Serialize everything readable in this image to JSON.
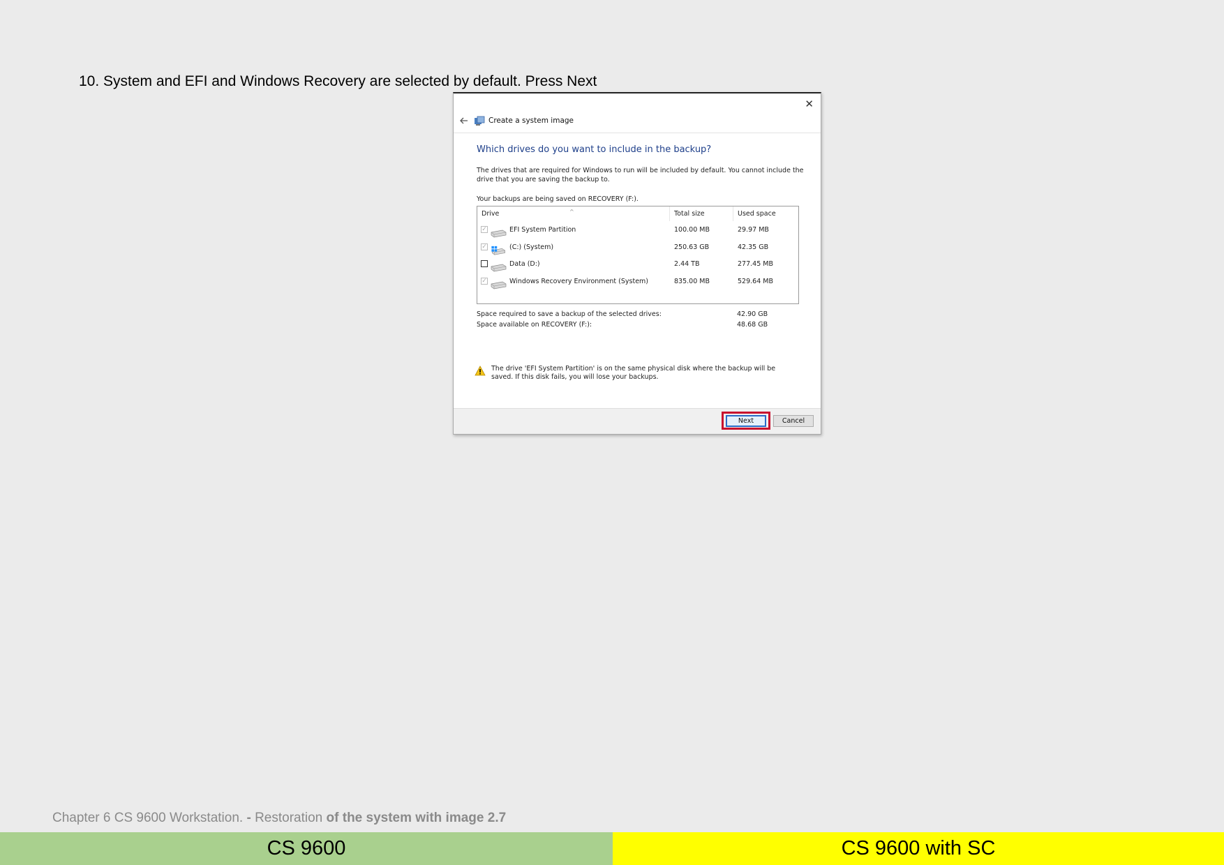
{
  "instruction": "10. System and EFI and Windows Recovery are selected by default. Press Next",
  "dialog": {
    "close_glyph": "✕",
    "title": "Create a system image",
    "heading": "Which drives do you want to include in the backup?",
    "description": "The drives that are required for Windows to run will be included by default. You cannot include the drive that you are saving the backup to.",
    "saved_on": "Your backups are being saved on RECOVERY (F:).",
    "columns": {
      "drive": "Drive",
      "total": "Total size",
      "used": "Used space"
    },
    "drives": [
      {
        "name": "EFI System Partition",
        "total": "100.00 MB",
        "used": "29.97 MB",
        "checked": true,
        "disabled": true,
        "icon": "drive-icon"
      },
      {
        "name": "(C:) (System)",
        "total": "250.63 GB",
        "used": "42.35 GB",
        "checked": true,
        "disabled": true,
        "icon": "windows-drive-icon"
      },
      {
        "name": "Data (D:)",
        "total": "2.44 TB",
        "used": "277.45 MB",
        "checked": false,
        "disabled": false,
        "icon": "drive-icon"
      },
      {
        "name": "Windows Recovery Environment (System)",
        "total": "835.00 MB",
        "used": "529.64 MB",
        "checked": true,
        "disabled": true,
        "icon": "drive-icon"
      }
    ],
    "space_required_label": "Space required to save a backup of the selected drives:",
    "space_required_value": "42.90 GB",
    "space_available_label": "Space available on RECOVERY (F:):",
    "space_available_value": "48.68 GB",
    "warning": "The drive 'EFI System Partition' is on the same physical disk where the backup will be saved. If this disk fails, you will lose your backups.",
    "next_label": "Next",
    "cancel_label": "Cancel",
    "highlight_color": "#c8102e"
  },
  "footer": {
    "chapter_prefix": "Chapter 6 CS 9600 Workstation. ",
    "chapter_dash": "- ",
    "chapter_middle": "Restoration ",
    "chapter_bold": "of the system with image 2.7",
    "left_band": "CS 9600",
    "right_band": "CS 9600 with SC",
    "left_color": "#a9d08e",
    "right_color": "#ffff00"
  }
}
